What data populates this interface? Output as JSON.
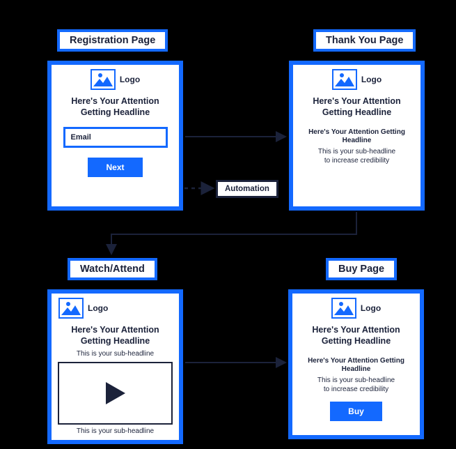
{
  "titles": {
    "registration": "Registration Page",
    "thankyou": "Thank You Page",
    "watch": "Watch/Attend",
    "buy": "Buy Page"
  },
  "automation_label": "Automation",
  "logo_label": "Logo",
  "registration": {
    "headline": "Here's Your Attention\nGetting Headline",
    "email_placeholder": "Email",
    "next_label": "Next"
  },
  "thankyou": {
    "headline": "Here's Your Attention\nGetting Headline",
    "headline2": "Here's Your Attention Getting Headline",
    "sub": "This is your sub-headline\nto increase credibility"
  },
  "watch": {
    "headline": "Here's Your Attention\nGetting Headline",
    "sub_top": "This is your sub-headline",
    "sub_bottom": "This is your sub-headline"
  },
  "buy": {
    "headline": "Here's Your Attention\nGetting Headline",
    "headline2": "Here's Your Attention Getting Headline",
    "sub": "This is your sub-headline\nto increase credibility",
    "buy_label": "Buy"
  }
}
